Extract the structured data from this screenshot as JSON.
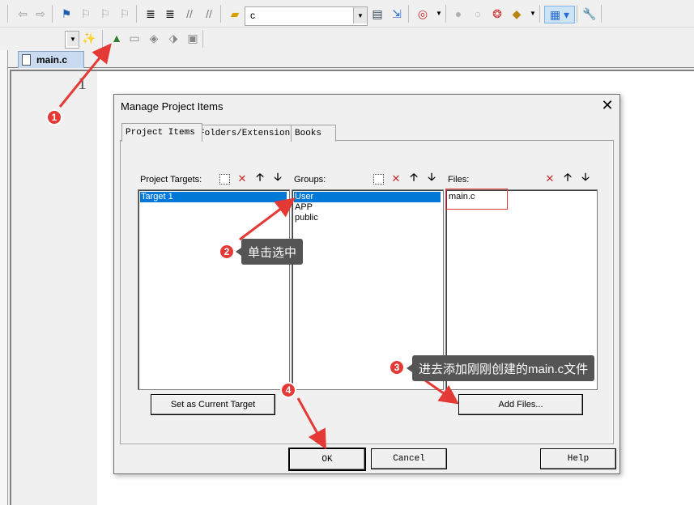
{
  "toolbar": {
    "target_combo_value": "c",
    "icons_row1": [
      "back-arrow-icon",
      "forward-arrow-icon",
      "bookmark-flag-icon",
      "bookmark-prev-icon",
      "bookmark-next-icon",
      "bookmark-clear-icon",
      "indent-icon",
      "unindent-icon",
      "comment-icon",
      "uncomment-icon",
      "open-folder-icon",
      "find-in-files-icon",
      "incremental-find-icon",
      "debug-session-icon",
      "breakpoint-icon",
      "breakpoint-disable-icon",
      "breakpoint-kill-icon",
      "breakpoint-all-icon",
      "window-layout-icon",
      "configure-icon"
    ],
    "icons_row2": [
      "manage-run-time-icon",
      "magic-wand-icon",
      "manage-project-items-icon",
      "copy-build-icon",
      "diamond-icon",
      "pack-installer-icon",
      "book-icon"
    ]
  },
  "editor": {
    "file_tab": "main.c",
    "line_number": "1"
  },
  "dialog": {
    "title": "Manage Project Items",
    "close": "✕",
    "tabs": [
      "Project Items",
      "Folders/Extensions",
      "Books"
    ],
    "targets": {
      "header": "Project Targets:",
      "items": [
        "Target 1"
      ]
    },
    "groups": {
      "header": "Groups:",
      "items": [
        "User",
        "APP",
        "public"
      ]
    },
    "files": {
      "header": "Files:",
      "items": [
        "main.c"
      ]
    },
    "buttons": {
      "set_current": "Set as Current Target",
      "add_files": "Add Files...",
      "ok": "OK",
      "cancel": "Cancel",
      "help": "Help"
    }
  },
  "annotations": [
    {
      "number": "1"
    },
    {
      "number": "2",
      "text": "单击选中"
    },
    {
      "number": "3",
      "text": "进去添加刚刚创建的main.c文件"
    },
    {
      "number": "4"
    }
  ],
  "colors": {
    "selection": "#0078d7",
    "annotation_red": "#e53935",
    "tooltip_bg": "#555555"
  }
}
